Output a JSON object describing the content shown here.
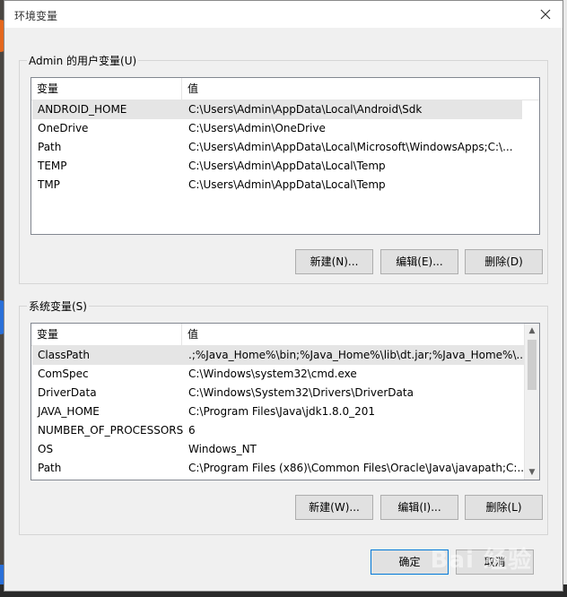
{
  "window": {
    "title": "环境变量"
  },
  "user_vars": {
    "group_label": "Admin 的用户变量(U)",
    "columns": [
      "变量",
      "值"
    ],
    "rows": [
      {
        "name": "ANDROID_HOME",
        "value": "C:\\Users\\Admin\\AppData\\Local\\Android\\Sdk"
      },
      {
        "name": "OneDrive",
        "value": "C:\\Users\\Admin\\OneDrive"
      },
      {
        "name": "Path",
        "value": "C:\\Users\\Admin\\AppData\\Local\\Microsoft\\WindowsApps;C:\\..."
      },
      {
        "name": "TEMP",
        "value": "C:\\Users\\Admin\\AppData\\Local\\Temp"
      },
      {
        "name": "TMP",
        "value": "C:\\Users\\Admin\\AppData\\Local\\Temp"
      }
    ],
    "buttons": {
      "new": "新建(N)...",
      "edit": "编辑(E)...",
      "delete": "删除(D)"
    }
  },
  "system_vars": {
    "group_label": "系统变量(S)",
    "columns": [
      "变量",
      "值"
    ],
    "rows": [
      {
        "name": "ClassPath",
        "value": ".;%Java_Home%\\bin;%Java_Home%\\lib\\dt.jar;%Java_Home%\\..."
      },
      {
        "name": "ComSpec",
        "value": "C:\\Windows\\system32\\cmd.exe"
      },
      {
        "name": "DriverData",
        "value": "C:\\Windows\\System32\\Drivers\\DriverData"
      },
      {
        "name": "JAVA_HOME",
        "value": "C:\\Program Files\\Java\\jdk1.8.0_201"
      },
      {
        "name": "NUMBER_OF_PROCESSORS",
        "value": "6"
      },
      {
        "name": "OS",
        "value": "Windows_NT"
      },
      {
        "name": "Path",
        "value": "C:\\Program Files (x86)\\Common Files\\Oracle\\Java\\javapath;C:..."
      }
    ],
    "buttons": {
      "new": "新建(W)...",
      "edit": "编辑(I)...",
      "delete": "删除(L)"
    }
  },
  "footer": {
    "ok": "确定",
    "cancel": "取消"
  },
  "watermark": "Bai 经验",
  "icons": {
    "close": "close-icon",
    "scroll_up": "chevron-up-icon",
    "scroll_down": "chevron-down-icon"
  }
}
